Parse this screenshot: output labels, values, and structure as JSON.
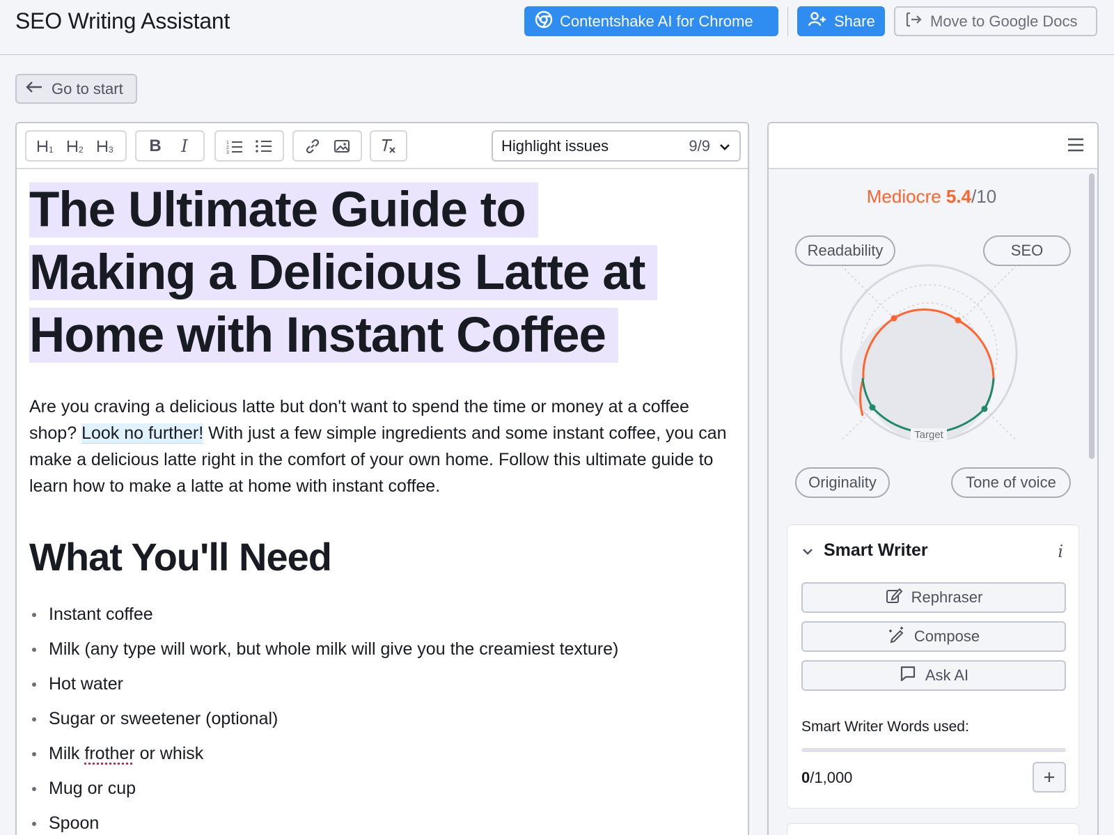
{
  "header": {
    "title": "SEO Writing Assistant",
    "chrome_button": "Contentshake AI for Chrome",
    "share_button": "Share",
    "docs_button": "Move to Google Docs"
  },
  "nav": {
    "go_to_start": "Go to start"
  },
  "toolbar": {
    "h1": "H1",
    "h2": "H2",
    "h3": "H3",
    "bold": "B",
    "italic": "I",
    "highlight_label": "Highlight issues",
    "highlight_count": "9/9"
  },
  "document": {
    "title_lines": [
      "The Ultimate Guide to",
      "Making a Delicious Latte at",
      "Home with Instant Coffee"
    ],
    "intro_before": "Are you craving a delicious latte but don't want to spend the time or money at a coffee shop? ",
    "intro_marked": "Look no further!",
    "intro_after": " With just a few simple ingredients and some instant coffee, you can make a delicious latte right in the comfort of your own home. Follow this ultimate guide to learn how to make a latte at home with instant coffee.",
    "section_heading": "What You'll Need",
    "list": [
      "Instant coffee",
      "Milk (any type will work, but whole milk will give you the creamiest texture)",
      "Hot water",
      "Sugar or sweetener (optional)",
      "Mug or cup",
      "Spoon"
    ],
    "list_item_frother_before": "Milk ",
    "list_item_frother_word": "frother",
    "list_item_frother_after": " or whisk"
  },
  "score": {
    "label": "Mediocre",
    "value": "5.4",
    "max": "/10",
    "color": "#ff642d"
  },
  "radar": {
    "axes": [
      "Readability",
      "SEO",
      "Originality",
      "Tone of voice"
    ],
    "target_label": "Target",
    "colors": {
      "weak": "#ff642d",
      "good": "#1f8a6a"
    }
  },
  "smart_writer": {
    "title": "Smart Writer",
    "info": "i",
    "rephraser": "Rephraser",
    "compose": "Compose",
    "ask_ai": "Ask AI",
    "words_label": "Smart Writer Words used:",
    "words_used": "0",
    "words_limit": "/1,000",
    "usage_fraction": 0
  }
}
